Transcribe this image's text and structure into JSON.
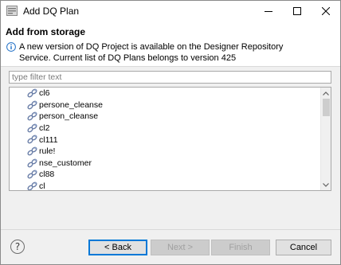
{
  "window": {
    "title": "Add DQ Plan"
  },
  "header": {
    "title": "Add from storage",
    "info_line_1": "A new version of DQ Project is available on the Designer Repository",
    "info_line_2": "Service. Current list of DQ Plans belongs to version 425"
  },
  "filter": {
    "placeholder": "type filter text",
    "value": ""
  },
  "list": {
    "items": [
      {
        "label": "cl6"
      },
      {
        "label": "persone_cleanse"
      },
      {
        "label": "person_cleanse"
      },
      {
        "label": "cl2"
      },
      {
        "label": "cl111"
      },
      {
        "label": "rule!"
      },
      {
        "label": "nse_customer"
      },
      {
        "label": "cl88"
      },
      {
        "label": "cl"
      }
    ]
  },
  "buttons": {
    "help": "?",
    "back": "< Back",
    "next": "Next >",
    "finish": "Finish",
    "cancel": "Cancel"
  },
  "icons": {
    "app": "dq-plan-icon",
    "info": "info-icon",
    "plan": "plan-link-icon"
  },
  "colors": {
    "focus_border": "#0078d7",
    "info_blue": "#1f6fc6",
    "plan_icon": "#6b7fa8"
  }
}
